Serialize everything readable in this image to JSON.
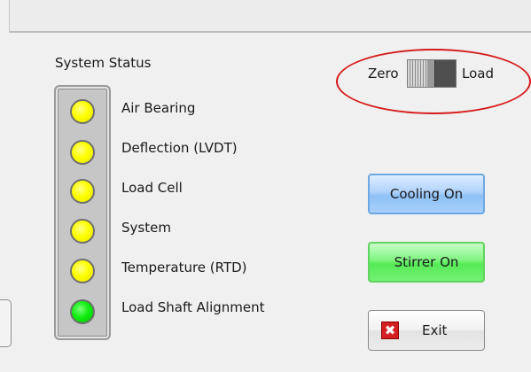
{
  "system_status": {
    "title": "System Status",
    "indicators": [
      {
        "label": "Air Bearing",
        "state": "yellow"
      },
      {
        "label": "Deflection (LVDT)",
        "state": "yellow"
      },
      {
        "label": "Load Cell",
        "state": "yellow"
      },
      {
        "label": "System",
        "state": "yellow"
      },
      {
        "label": "Temperature (RTD)",
        "state": "yellow"
      },
      {
        "label": "Load Shaft Alignment",
        "state": "green"
      }
    ]
  },
  "mode_switch": {
    "left_label": "Zero",
    "right_label": "Load",
    "position": "zero"
  },
  "buttons": {
    "cooling": "Cooling On",
    "stirrer": "Stirrer On",
    "exit": "Exit",
    "exit_icon": "✖"
  },
  "colors": {
    "led_yellow": "#ffff00",
    "led_green": "#10ee10",
    "highlight": "#d61a1a",
    "cooling_button": "#8ec0f6",
    "stirrer_button": "#56ea56"
  }
}
